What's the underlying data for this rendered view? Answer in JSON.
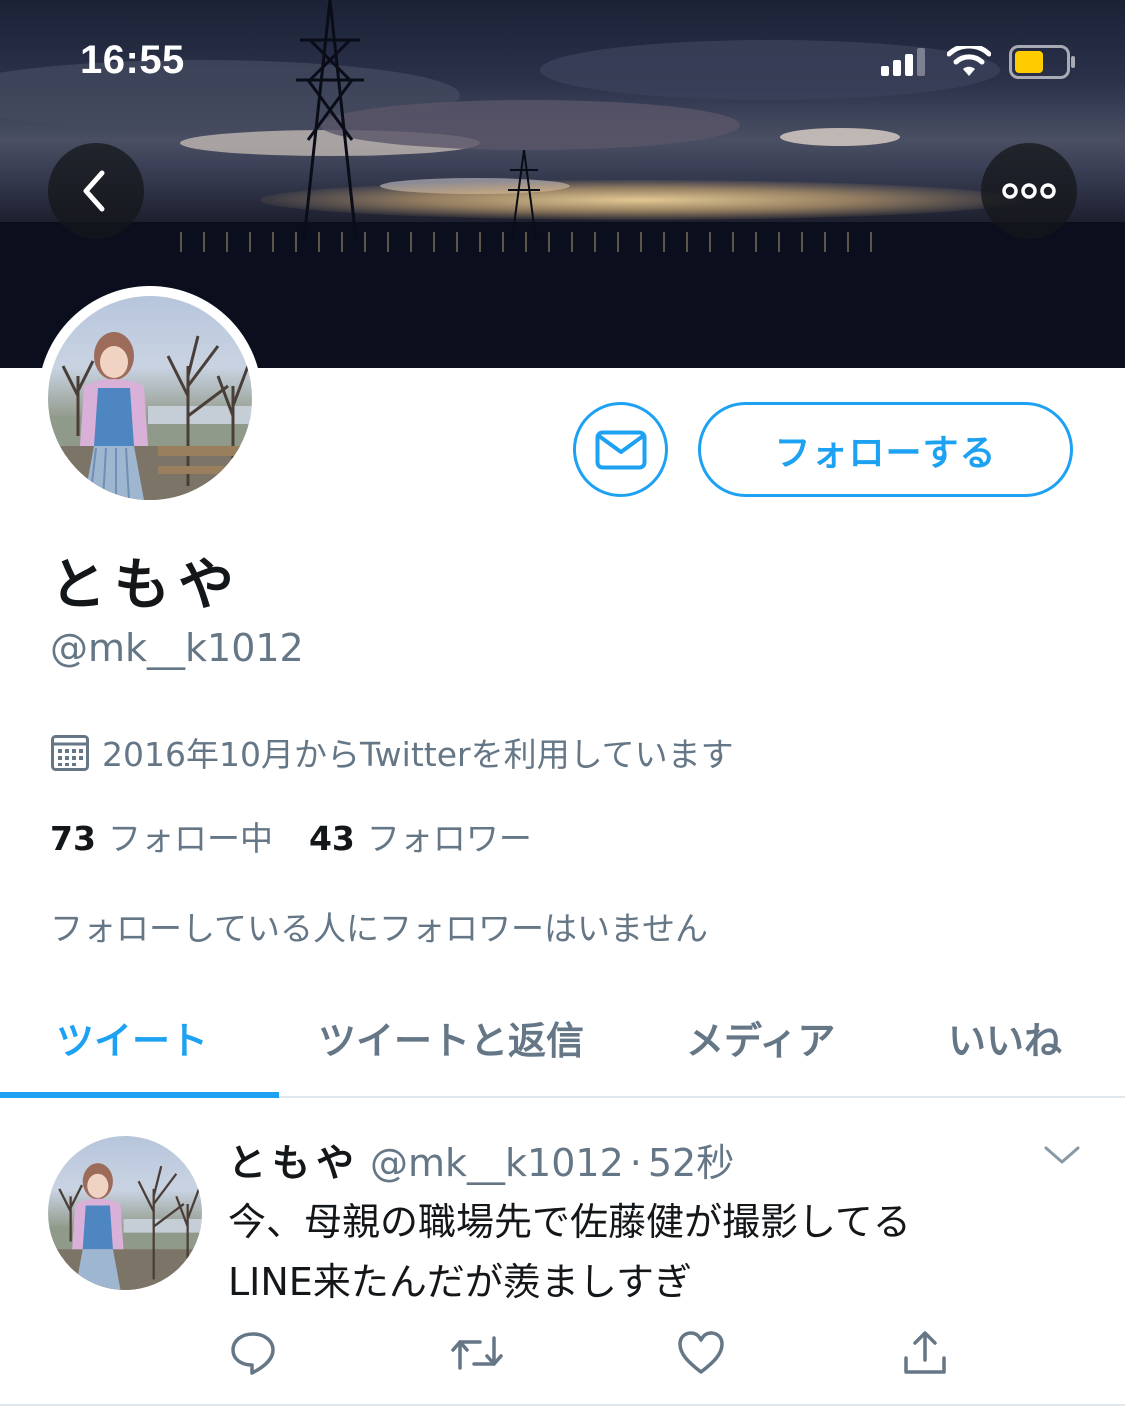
{
  "status_bar": {
    "time": "16:55"
  },
  "header": {
    "back_icon": "chevron-left-icon",
    "more_icon": "ellipsis-icon"
  },
  "profile": {
    "display_name": "ともや",
    "handle": "@mk__k1012",
    "joined": "2016年10月からTwitterを利用しています",
    "following_count": "73",
    "following_label": "フォロー中",
    "followers_count": "43",
    "followers_label": "フォロワー",
    "mutual_note": "フォローしている人にフォロワーはいません",
    "follow_button": "フォローする",
    "dm_icon": "envelope-icon"
  },
  "tabs": [
    {
      "label": "ツイート",
      "active": true
    },
    {
      "label": "ツイートと返信",
      "active": false
    },
    {
      "label": "メディア",
      "active": false
    },
    {
      "label": "いいね",
      "active": false
    }
  ],
  "tweet": {
    "name": "ともや",
    "handle": "@mk__k1012",
    "separator": "·",
    "time": "52秒",
    "text_line1": "今、母親の職場先で佐藤健が撮影してる",
    "text_line2": "LINE来たんだが羨ましすぎ"
  },
  "colors": {
    "accent": "#1da1f2",
    "secondary_text": "#657786",
    "primary_text": "#14171a",
    "battery": "#ffcc00"
  }
}
